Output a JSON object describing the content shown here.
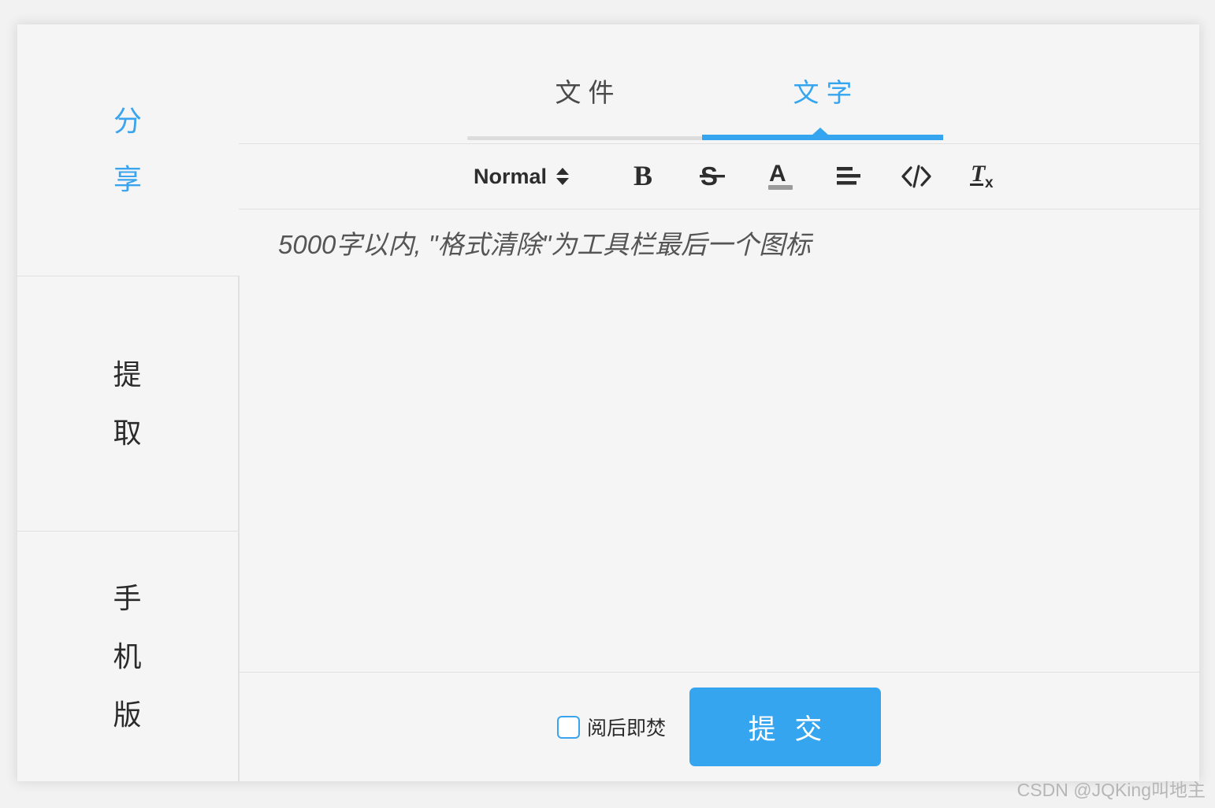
{
  "theme": {
    "accent": "#36a5f0",
    "page_bg": "#f2f2f2",
    "card_bg": "#f5f5f5",
    "border": "#dfdfdf",
    "text": "#2b2b2b",
    "muted": "#555555"
  },
  "sidebar": {
    "items": [
      {
        "id": "share",
        "label": "分享",
        "chars": [
          "分",
          "享"
        ],
        "active": true
      },
      {
        "id": "extract",
        "label": "提取",
        "chars": [
          "提",
          "取"
        ],
        "active": false
      },
      {
        "id": "mobile",
        "label": "手机版",
        "chars": [
          "手",
          "机",
          "版"
        ],
        "active": false
      }
    ]
  },
  "tabs": {
    "items": [
      {
        "id": "file",
        "label": "文件",
        "active": false
      },
      {
        "id": "text",
        "label": "文字",
        "active": true
      }
    ]
  },
  "toolbar": {
    "size_picker": {
      "value": "Normal",
      "icon": "chevron-updown-icon"
    },
    "buttons": [
      {
        "id": "bold",
        "icon": "bold-icon",
        "label": "B"
      },
      {
        "id": "strike",
        "icon": "strikethrough-icon",
        "label": "S"
      },
      {
        "id": "color",
        "icon": "text-color-icon",
        "label": "A"
      },
      {
        "id": "align",
        "icon": "align-left-icon",
        "label": ""
      },
      {
        "id": "code",
        "icon": "code-icon",
        "label": "</>"
      },
      {
        "id": "clear-format",
        "icon": "clear-format-icon",
        "label": "Tx"
      }
    ]
  },
  "editor": {
    "placeholder": "5000字以内, \"格式清除\"为工具栏最后一个图标",
    "value": ""
  },
  "footer": {
    "burn_after_reading": {
      "label": "阅后即焚",
      "checked": false
    },
    "submit_label": "提 交"
  },
  "watermark": {
    "text": "CSDN @JQKing叫地主"
  }
}
